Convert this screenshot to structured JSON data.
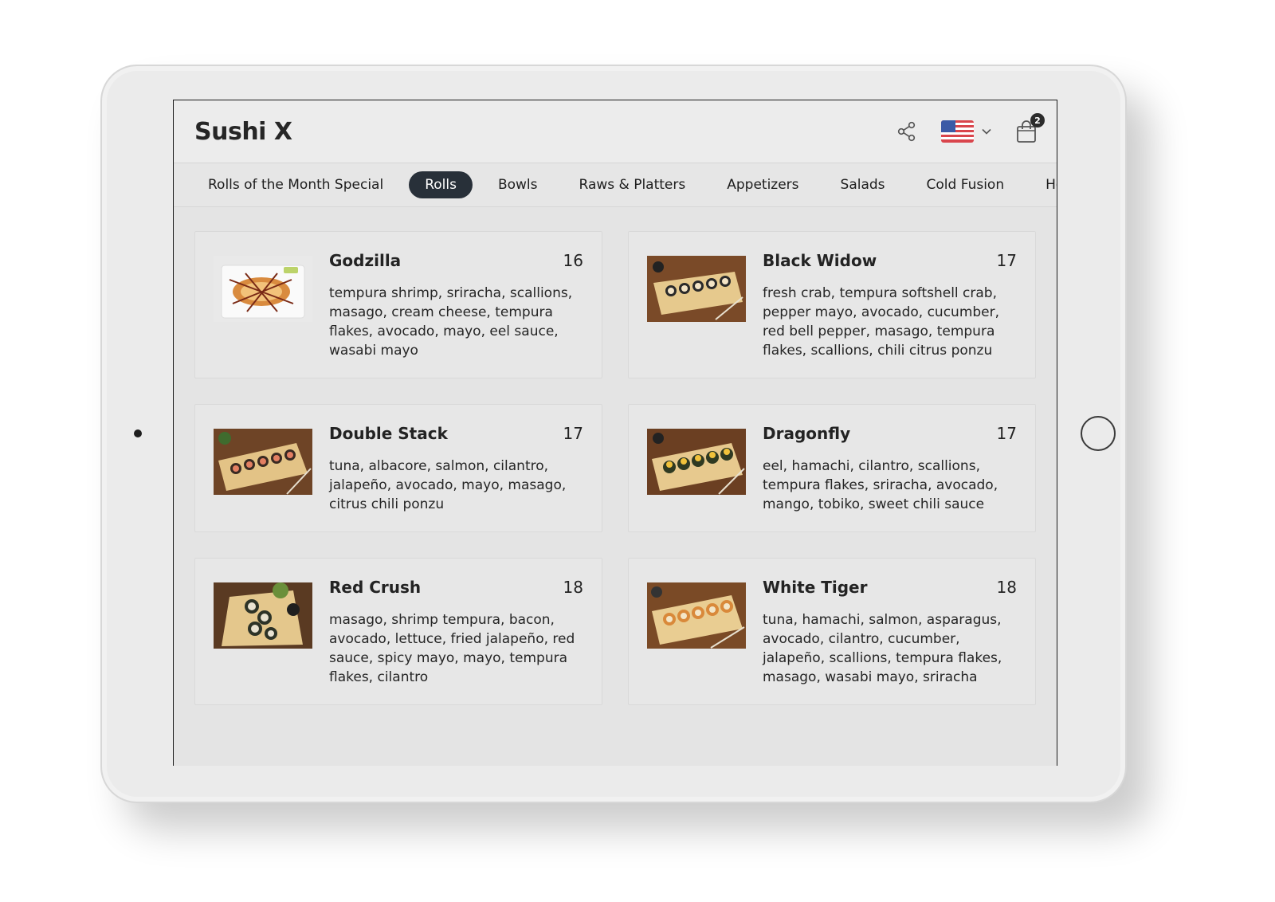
{
  "app": {
    "brand": "Sushi X"
  },
  "header": {
    "share_icon": "share-icon",
    "language_flag": "us-flag-icon",
    "cart_icon": "shopping-bag-icon",
    "cart_count": "2"
  },
  "tabs": [
    {
      "label": "Rolls of the Month Special",
      "active": false
    },
    {
      "label": "Rolls",
      "active": true
    },
    {
      "label": "Bowls",
      "active": false
    },
    {
      "label": "Raws & Platters",
      "active": false
    },
    {
      "label": "Appetizers",
      "active": false
    },
    {
      "label": "Salads",
      "active": false
    },
    {
      "label": "Cold Fusion",
      "active": false
    },
    {
      "label": "Hot Appetizers",
      "active": false
    }
  ],
  "items": [
    {
      "name": "Godzilla",
      "price": "16",
      "description": "tempura shrimp, sriracha, scallions, masago, cream cheese, tempura flakes, avocado, mayo, eel sauce, wasabi mayo"
    },
    {
      "name": "Black Widow",
      "price": "17",
      "description": "fresh crab, tempura softshell crab, pepper mayo, avocado, cucumber, red bell pepper, masago, tempura flakes, scallions, chili citrus ponzu"
    },
    {
      "name": "Double Stack",
      "price": "17",
      "description": "tuna, albacore, salmon, cilantro, jalapeño, avocado, mayo, masago, citrus chili ponzu"
    },
    {
      "name": "Dragonfly",
      "price": "17",
      "description": "eel, hamachi, cilantro, scallions, tempura flakes, sriracha, avocado, mango, tobiko, sweet chili sauce"
    },
    {
      "name": "Red Crush",
      "price": "18",
      "description": "masago, shrimp tempura, bacon, avocado, lettuce, fried jalapeño, red sauce, spicy mayo, mayo, tempura flakes, cilantro"
    },
    {
      "name": "White Tiger",
      "price": "18",
      "description": "tuna, hamachi, salmon, asparagus, avocado, cilantro, cucumber, jalapeño, scallions, tempura flakes, masago, wasabi mayo, sriracha"
    }
  ],
  "colors": {
    "active_tab": "#283039",
    "screen_bg": "#e4e4e4",
    "device": "#ebebeb"
  }
}
